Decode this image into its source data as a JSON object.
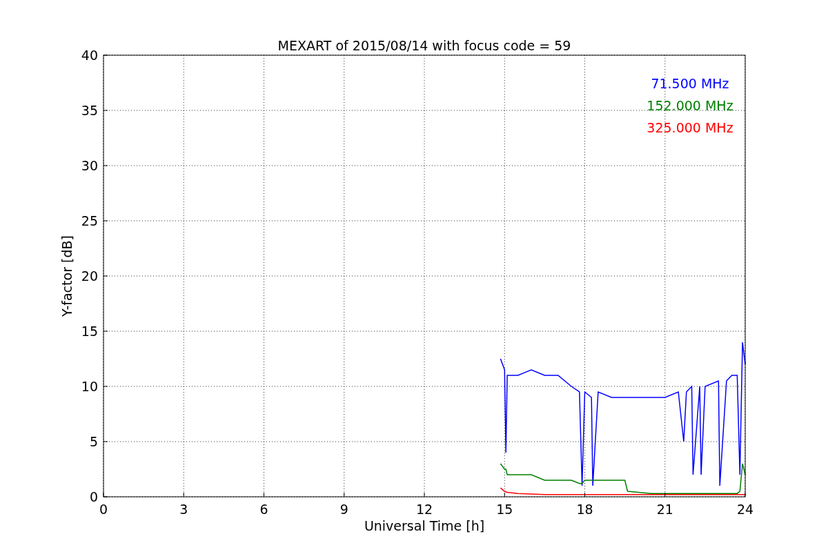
{
  "chart_data": {
    "type": "line",
    "title": "MEXART of 2015/08/14 with focus code = 59",
    "xlabel": "Universal Time [h]",
    "ylabel": "Y-factor [dB]",
    "xlim": [
      0,
      24
    ],
    "ylim": [
      0,
      40
    ],
    "xticks": [
      0,
      3,
      6,
      9,
      12,
      15,
      18,
      21,
      24
    ],
    "yticks": [
      0,
      5,
      10,
      15,
      20,
      25,
      30,
      35,
      40
    ],
    "grid": true,
    "x": [
      14.85,
      15,
      15.05,
      15.1,
      15.5,
      16,
      16.5,
      17,
      17.5,
      17.8,
      17.9,
      18,
      18.25,
      18.3,
      18.5,
      19,
      19.5,
      19.6,
      20,
      20.5,
      21,
      21.5,
      21.7,
      21.8,
      22,
      22.05,
      22.3,
      22.35,
      22.5,
      23,
      23.05,
      23.3,
      23.5,
      23.7,
      23.8,
      23.9,
      24
    ],
    "series": [
      {
        "name": "71.500 MHz",
        "color": "#0000ff",
        "values": [
          12.5,
          11.5,
          4,
          11,
          11,
          11.5,
          11,
          11,
          10,
          9.5,
          1,
          9.5,
          9,
          1,
          9.5,
          9,
          9,
          9,
          9,
          9,
          9,
          9.5,
          5,
          9.5,
          10,
          2,
          10,
          2,
          10,
          10.5,
          1,
          10.5,
          11,
          11,
          2,
          14,
          12
        ]
      },
      {
        "name": "152.000 MHz",
        "color": "#008000",
        "values": [
          3,
          2.5,
          2.5,
          2,
          2,
          2,
          1.5,
          1.5,
          1.5,
          1.2,
          1.2,
          1.5,
          1.5,
          1.5,
          1.5,
          1.5,
          1.5,
          0.5,
          0.4,
          0.3,
          0.3,
          0.3,
          0.3,
          0.3,
          0.3,
          0.3,
          0.3,
          0.3,
          0.3,
          0.3,
          0.3,
          0.3,
          0.3,
          0.3,
          0.5,
          3,
          2
        ]
      },
      {
        "name": "325.000 MHz",
        "color": "#ff0000",
        "values": [
          0.8,
          0.5,
          0.45,
          0.4,
          0.3,
          0.25,
          0.2,
          0.2,
          0.2,
          0.2,
          0.2,
          0.2,
          0.2,
          0.2,
          0.2,
          0.2,
          0.2,
          0.2,
          0.2,
          0.2,
          0.2,
          0.2,
          0.2,
          0.2,
          0.2,
          0.2,
          0.2,
          0.2,
          0.2,
          0.2,
          0.2,
          0.2,
          0.2,
          0.2,
          0.2,
          0.2,
          0.2
        ]
      }
    ]
  }
}
